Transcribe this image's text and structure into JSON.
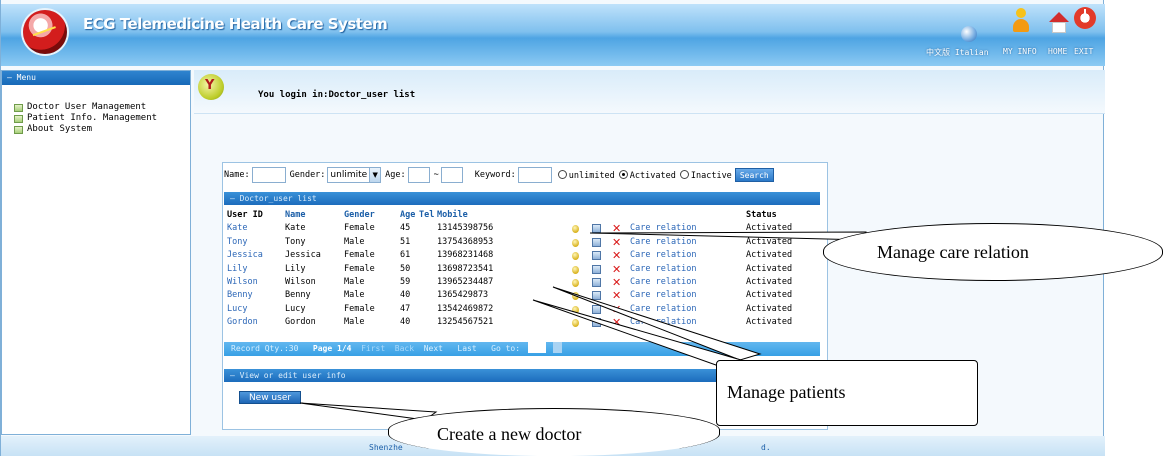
{
  "header": {
    "title": "ECG Telemedicine Health Care System",
    "language_label": "中文版  Italian",
    "nav": [
      "MY INFO",
      "HOME",
      "EXIT"
    ]
  },
  "sidebar": {
    "title": "— Menu",
    "items": [
      {
        "label": "Doctor User Management"
      },
      {
        "label": "Patient Info. Management"
      },
      {
        "label": "About System"
      }
    ]
  },
  "banner": {
    "login_text": "You login in:Doctor_user list"
  },
  "search": {
    "name_label": "Name:",
    "gender_label": "Gender:",
    "gender_value": "unlimite",
    "age_label": "Age:",
    "age_separator": "~",
    "keyword_label": "Keyword:",
    "radios": [
      {
        "label": "unlimited",
        "checked": false
      },
      {
        "label": "Activated",
        "checked": true
      },
      {
        "label": "Inactive",
        "checked": false
      }
    ],
    "search_button": "Search"
  },
  "list": {
    "title": "— Doctor_user list",
    "columns": [
      "User ID",
      "Name",
      "Gender",
      "Age",
      "Tel",
      "Mobile",
      "Status"
    ],
    "action_label": "Care relation",
    "rows": [
      {
        "id": "Kate",
        "name": "Kate",
        "gender": "Female",
        "age": "45",
        "mobile": "13145398756",
        "status": "Activated"
      },
      {
        "id": "Tony",
        "name": "Tony",
        "gender": "Male",
        "age": "51",
        "mobile": "13754368953",
        "status": "Activated"
      },
      {
        "id": "Jessica",
        "name": "Jessica",
        "gender": "Female",
        "age": "61",
        "mobile": "13968231468",
        "status": "Activated"
      },
      {
        "id": "Lily",
        "name": "Lily",
        "gender": "Female",
        "age": "50",
        "mobile": "13698723541",
        "status": "Activated"
      },
      {
        "id": "Wilson",
        "name": "Wilson",
        "gender": "Male",
        "age": "59",
        "mobile": "13965234487",
        "status": "Activated"
      },
      {
        "id": "Benny",
        "name": "Benny",
        "gender": "Male",
        "age": "40",
        "mobile": "1365429873",
        "status": "Activated"
      },
      {
        "id": "Lucy",
        "name": "Lucy",
        "gender": "Female",
        "age": "47",
        "mobile": "13542469872",
        "status": "Activated"
      },
      {
        "id": "Gordon",
        "name": "Gordon",
        "gender": "Male",
        "age": "40",
        "mobile": "13254567521",
        "status": "Activated"
      }
    ],
    "footer": {
      "record_qty": "Record Qty.:30",
      "page": "Page 1/4",
      "first": "First",
      "back": "Back",
      "next": "Next",
      "last": "Last",
      "goto": "Go to:"
    }
  },
  "edit_section": {
    "title": "— View or edit user info",
    "new_user_button": "New user"
  },
  "company_footer": {
    "left": "Shenzhe",
    "right": "d."
  },
  "callouts": {
    "care_relation": "Manage care relation",
    "patients": "Manage patients",
    "new_doctor": "Create a new doctor"
  }
}
